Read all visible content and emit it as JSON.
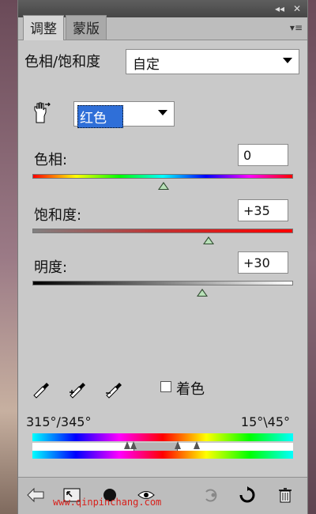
{
  "tabs": [
    "调整",
    "蒙版"
  ],
  "adjustment": {
    "title": "色相/饱和度",
    "preset_value": "自定"
  },
  "channel": {
    "selected": "红色"
  },
  "controls": {
    "hue": {
      "label": "色相:",
      "value": "0",
      "slider_fraction": 0.5
    },
    "saturation": {
      "label": "饱和度:",
      "value": "+35",
      "slider_fraction": 0.675
    },
    "lightness": {
      "label": "明度:",
      "value": "+30",
      "slider_fraction": 0.65
    }
  },
  "colorize": {
    "label": "着色",
    "checked": false
  },
  "range": {
    "left": "315°/345°",
    "right": "15°\\45°"
  },
  "watermark": "www.qinpinchang.com",
  "icons": {
    "targeted_adjust": "hand-arrows-icon",
    "eyedropper": "eyedropper-icon",
    "eyedropper_plus": "eyedropper-plus-icon",
    "eyedropper_minus": "eyedropper-minus-icon"
  }
}
